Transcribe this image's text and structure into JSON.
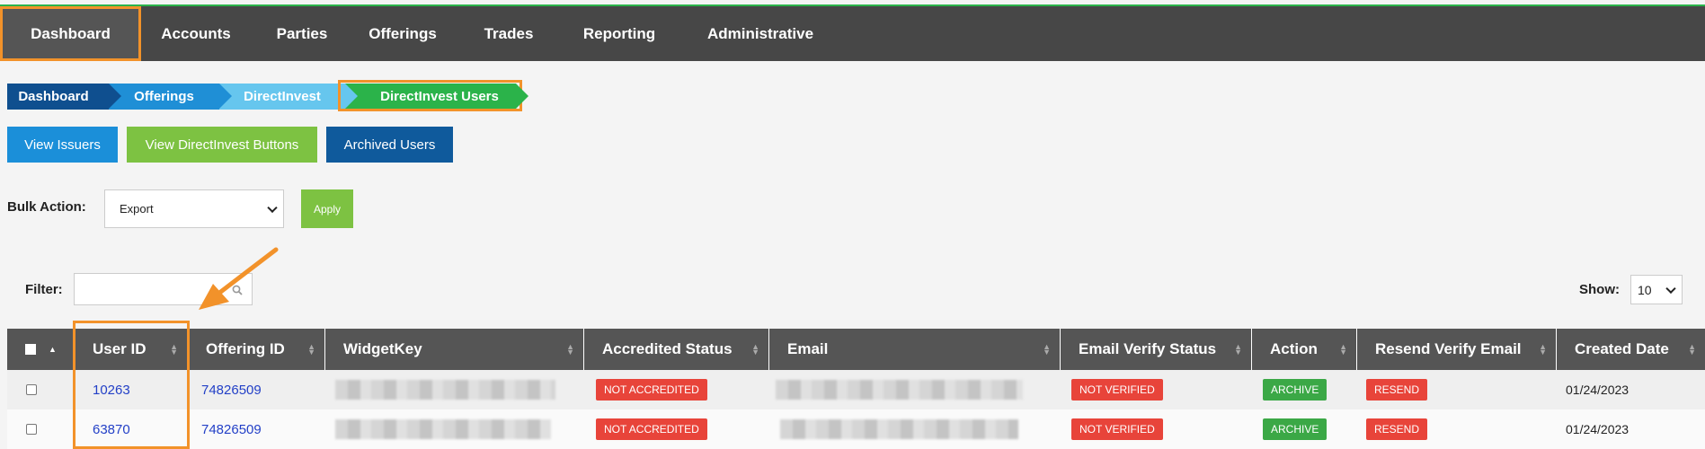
{
  "nav": {
    "items": [
      "Dashboard",
      "Accounts",
      "Parties",
      "Offerings",
      "Trades",
      "Reporting",
      "Administrative"
    ],
    "active": "Dashboard"
  },
  "breadcrumb": [
    "Dashboard",
    "Offerings",
    "DirectInvest",
    "DirectInvest Users"
  ],
  "buttons": {
    "view_issuers": "View Issuers",
    "view_buttons": "View DirectInvest Buttons",
    "archived": "Archived Users",
    "apply": "Apply"
  },
  "bulk": {
    "label": "Bulk Action:",
    "selected": "Export"
  },
  "filter": {
    "label": "Filter:",
    "value": ""
  },
  "show": {
    "label": "Show:",
    "selected": "10"
  },
  "table": {
    "columns": [
      "User ID",
      "Offering ID",
      "WidgetKey",
      "Accredited Status",
      "Email",
      "Email Verify Status",
      "Action",
      "Resend Verify Email",
      "Created Date"
    ],
    "rows": [
      {
        "user_id": "10263",
        "offering_id": "74826509",
        "accredited": "NOT ACCREDITED",
        "verify": "NOT VERIFIED",
        "action": "ARCHIVE",
        "resend": "RESEND",
        "created": "01/24/2023"
      },
      {
        "user_id": "63870",
        "offering_id": "74826509",
        "accredited": "NOT ACCREDITED",
        "verify": "NOT VERIFIED",
        "action": "ARCHIVE",
        "resend": "RESEND",
        "created": "01/24/2023"
      }
    ]
  },
  "colors": {
    "nav_bg": "#474747",
    "accent_orange": "#f2922a",
    "green": "#2bb34a",
    "badge_red": "#e8443a",
    "badge_green": "#3ba846"
  }
}
